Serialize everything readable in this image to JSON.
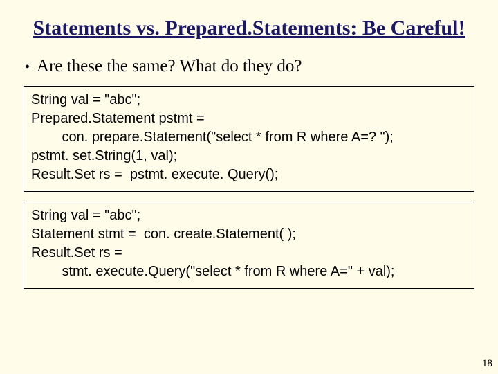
{
  "title": "Statements vs. Prepared.Statements: Be Careful!",
  "bullet": "Are these the same? What do they do?",
  "code1": {
    "l1": "String val = \"abc\";",
    "l2": "Prepared.Statement pstmt =",
    "l3": "        con. prepare.Statement(\"select * from R where A=? \");",
    "l4": "pstmt. set.String(1, val);",
    "l5": "Result.Set rs =  pstmt. execute. Query();"
  },
  "code2": {
    "l1": "String val = \"abc\";",
    "l2": "Statement stmt =  con. create.Statement( );",
    "l3": "Result.Set rs =",
    "l4": "        stmt. execute.Query(\"select * from R where A=\" + val);"
  },
  "pageNumber": "18"
}
